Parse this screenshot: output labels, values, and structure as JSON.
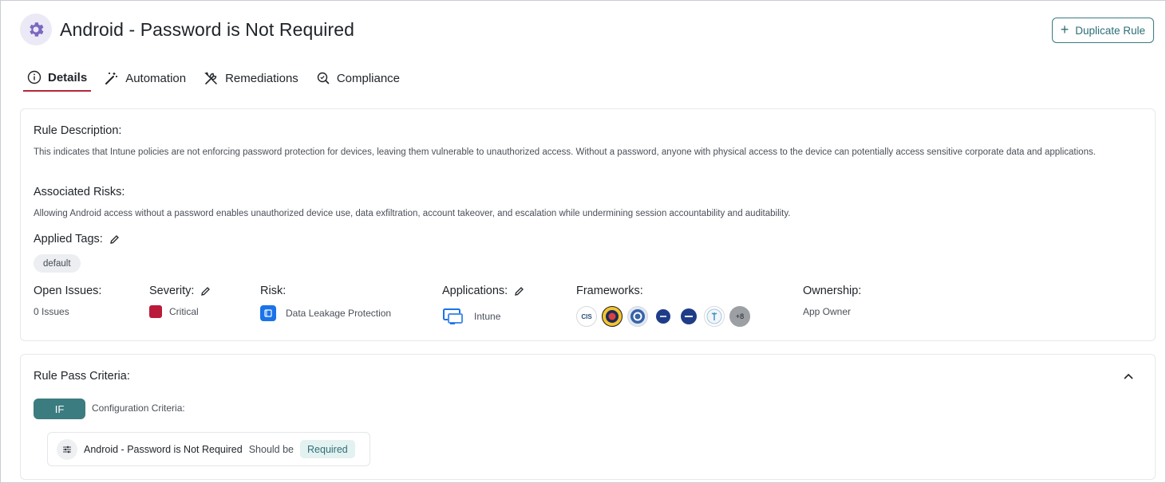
{
  "header": {
    "title": "Android - Password is Not Required",
    "icon": "gear-icon",
    "duplicate_label": "Duplicate Rule"
  },
  "tabs": [
    {
      "label": "Details",
      "icon": "info-icon",
      "active": true
    },
    {
      "label": "Automation",
      "icon": "magic-wand-icon",
      "active": false
    },
    {
      "label": "Remediations",
      "icon": "tools-icon",
      "active": false
    },
    {
      "label": "Compliance",
      "icon": "search-check-icon",
      "active": false
    }
  ],
  "details": {
    "description_label": "Rule Description:",
    "description": "This indicates that Intune policies are not enforcing password protection for devices, leaving them vulnerable to unauthorized access. Without a password, anyone with physical access to the device can potentially access sensitive corporate data and applications.",
    "risks_label": "Associated Risks:",
    "risks": "Allowing Android access without a password enables unauthorized device use, data exfiltration, account takeover, and escalation while undermining session accountability and auditability.",
    "tags_label": "Applied Tags:",
    "tags": [
      "default"
    ],
    "open_issues_label": "Open Issues:",
    "open_issues_value": "0 Issues",
    "severity_label": "Severity:",
    "severity_value": "Critical",
    "risk_label": "Risk:",
    "risk_value": "Data Leakage Protection",
    "applications_label": "Applications:",
    "applications_value": "Intune",
    "frameworks_label": "Frameworks:",
    "frameworks": [
      "CIS",
      "",
      "",
      "",
      "",
      ""
    ],
    "frameworks_more": "+8",
    "ownership_label": "Ownership:",
    "ownership_value": "App Owner"
  },
  "criteria": {
    "title": "Rule Pass Criteria:",
    "if_label": "IF",
    "config_label": "Configuration Criteria:",
    "item_name": "Android - Password is Not Required",
    "item_operator": "Should be",
    "item_value": "Required"
  },
  "colors": {
    "accent": "#3b7c80",
    "critical": "#b91c3a",
    "active_tab": "#b5263a",
    "risk_blue": "#1b73e8",
    "rule_icon": "#7b68c0"
  }
}
